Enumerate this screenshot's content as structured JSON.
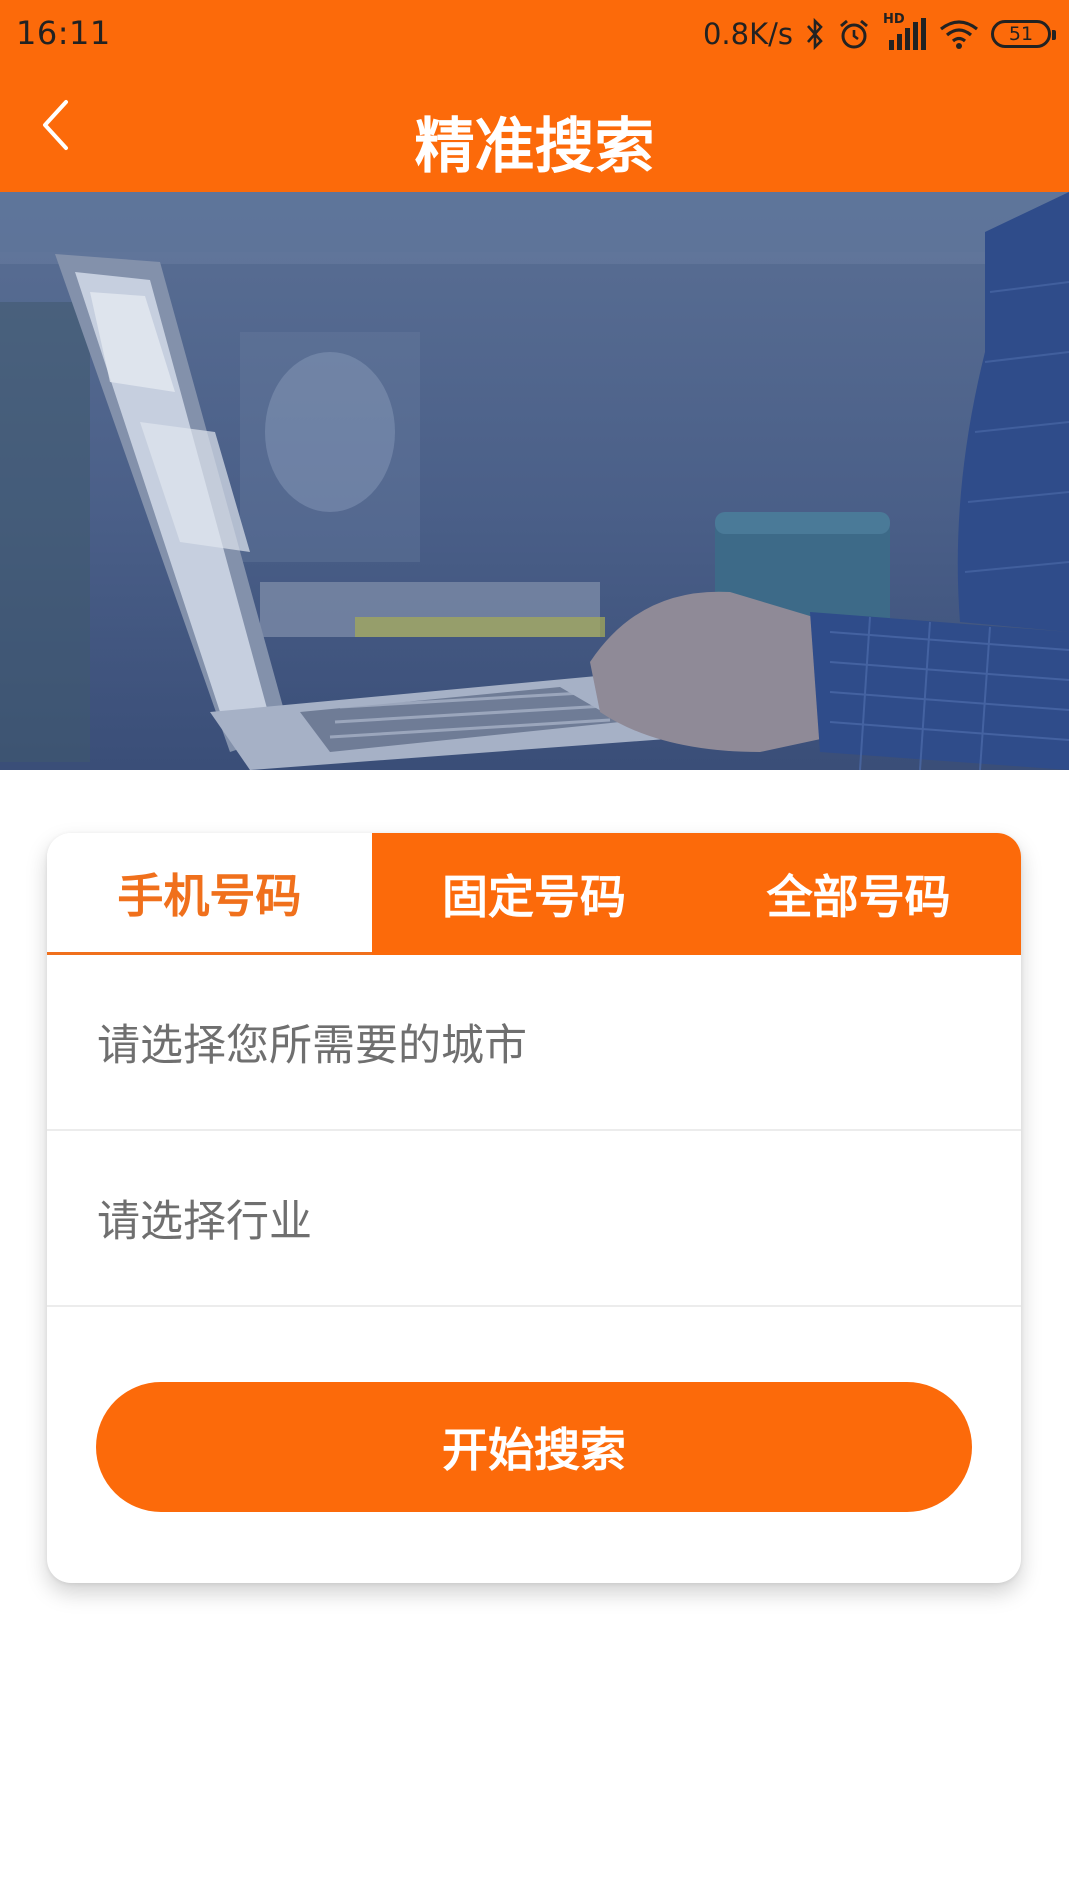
{
  "status_bar": {
    "time": "16:11",
    "network_speed": "0.8K/s",
    "signal_label": "HD",
    "battery": "51",
    "icons": [
      "bluetooth-icon",
      "alarm-icon",
      "signal-icon",
      "wifi-icon",
      "battery-icon"
    ]
  },
  "header": {
    "title": "精准搜索",
    "back_icon": "chevron-left-icon",
    "background_color": "#fc6a0a"
  },
  "hero": {
    "description_icon": "laptop-photo"
  },
  "tabs": [
    {
      "label": "手机号码",
      "active": true
    },
    {
      "label": "固定号码",
      "active": false
    },
    {
      "label": "全部号码",
      "active": false
    }
  ],
  "form": {
    "city_placeholder": "请选择您所需要的城市",
    "industry_placeholder": "请选择行业",
    "search_label": "开始搜索"
  },
  "colors": {
    "accent": "#fc6a0a",
    "active_tab_text": "#f0701c",
    "placeholder_text": "#6f6f6f"
  }
}
